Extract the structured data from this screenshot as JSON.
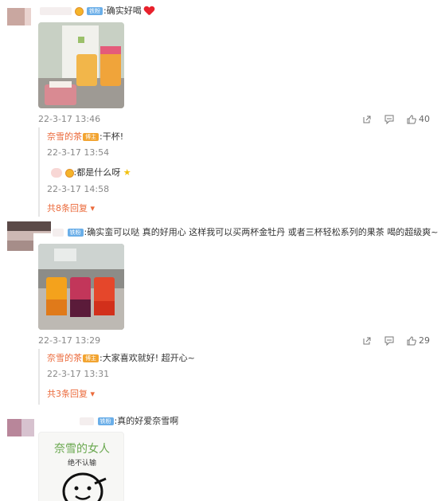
{
  "comments": [
    {
      "text": ":确实好喝",
      "badge": "铁粉",
      "time": "22-3-17 13:46",
      "likes": "40",
      "replies": [
        {
          "name": "奈雪的茶",
          "badge": "博主",
          "text": ":干杯!",
          "time": "22-3-17 13:54"
        },
        {
          "name": "",
          "badge": "",
          "text": ":都是什么呀",
          "time": "22-3-17 14:58"
        }
      ],
      "more": "共8条回复"
    },
    {
      "text": ":确实蛮可以哒 真的好用心  这样我可以买两杯金牡丹 或者三杯轻松系列的果茶 喝的超级爽~",
      "badge": "铁粉",
      "time": "22-3-17 13:29",
      "likes": "29",
      "replies": [
        {
          "name": "奈雪的茶",
          "badge": "博主",
          "text": ":大家喜欢就好! 超开心~",
          "time": "22-3-17 13:31"
        }
      ],
      "more": "共3条回复"
    },
    {
      "text": ":真的好爱奈雪啊",
      "badge": "铁粉",
      "sticker": {
        "line1": "奈雪的女人",
        "line2": "绝不认输"
      }
    }
  ],
  "colors": {
    "accent": "#eb6a3b",
    "iron_badge": "#6aaee8",
    "host_badge": "#f2a431",
    "heart": "#e8212c"
  },
  "icons": {
    "share": "share-icon",
    "comment": "comment-icon",
    "like": "thumbs-up-icon"
  }
}
